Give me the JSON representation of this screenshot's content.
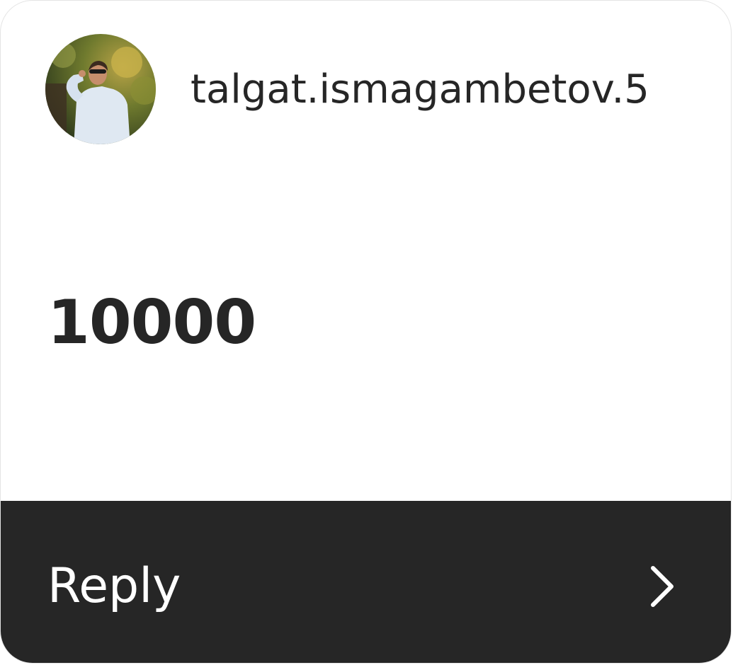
{
  "author": {
    "username": "talgat.ismagambetov.5",
    "avatar_icon": "profile-photo"
  },
  "message": {
    "text": "10000"
  },
  "reply": {
    "label": "Reply",
    "icon": "chevron-right-icon"
  },
  "colors": {
    "text": "#262626",
    "reply_bar": "#262626",
    "reply_text": "#ffffff",
    "card_border": "#e4e4e4"
  }
}
